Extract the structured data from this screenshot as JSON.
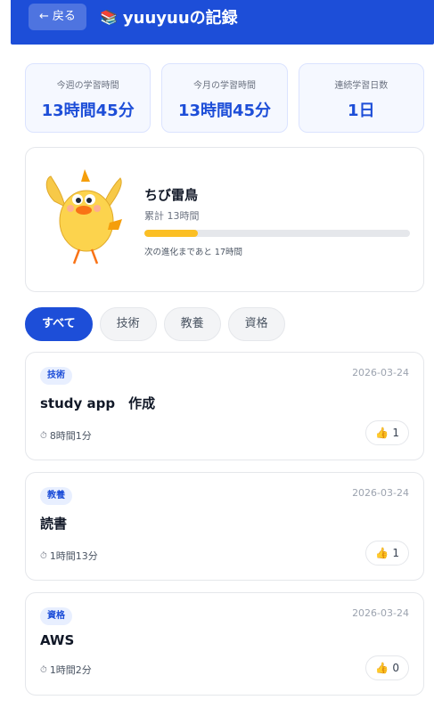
{
  "header": {
    "back_label": "戻る",
    "back_arrow": "←",
    "book_icon": "📚",
    "title": "yuuyuuの記録",
    "color": "#1d4ed8"
  },
  "stats": [
    {
      "label": "今週の学習時間",
      "value": "13時間45分"
    },
    {
      "label": "今月の学習時間",
      "value": "13時間45分"
    },
    {
      "label": "連続学習日数",
      "value": "1日"
    }
  ],
  "character": {
    "name": "ちび雷鳥",
    "total": "累計 13時間",
    "progress_percent": 20,
    "next": "次の進化まであと 17時間"
  },
  "filters": [
    "すべて",
    "技術",
    "教養",
    "資格"
  ],
  "records": [
    {
      "tag": "技術",
      "date": "2026-03-24",
      "title": "study app　作成",
      "duration": "8時間1分",
      "likes": "1"
    },
    {
      "tag": "教養",
      "date": "2026-03-24",
      "title": "読書",
      "duration": "1時間13分",
      "likes": "1"
    },
    {
      "tag": "資格",
      "date": "2026-03-24",
      "title": "AWS",
      "duration": "1時間2分",
      "likes": "0"
    }
  ],
  "icons": {
    "clock": "clock-icon",
    "thumb": "thumbs-up-icon"
  }
}
